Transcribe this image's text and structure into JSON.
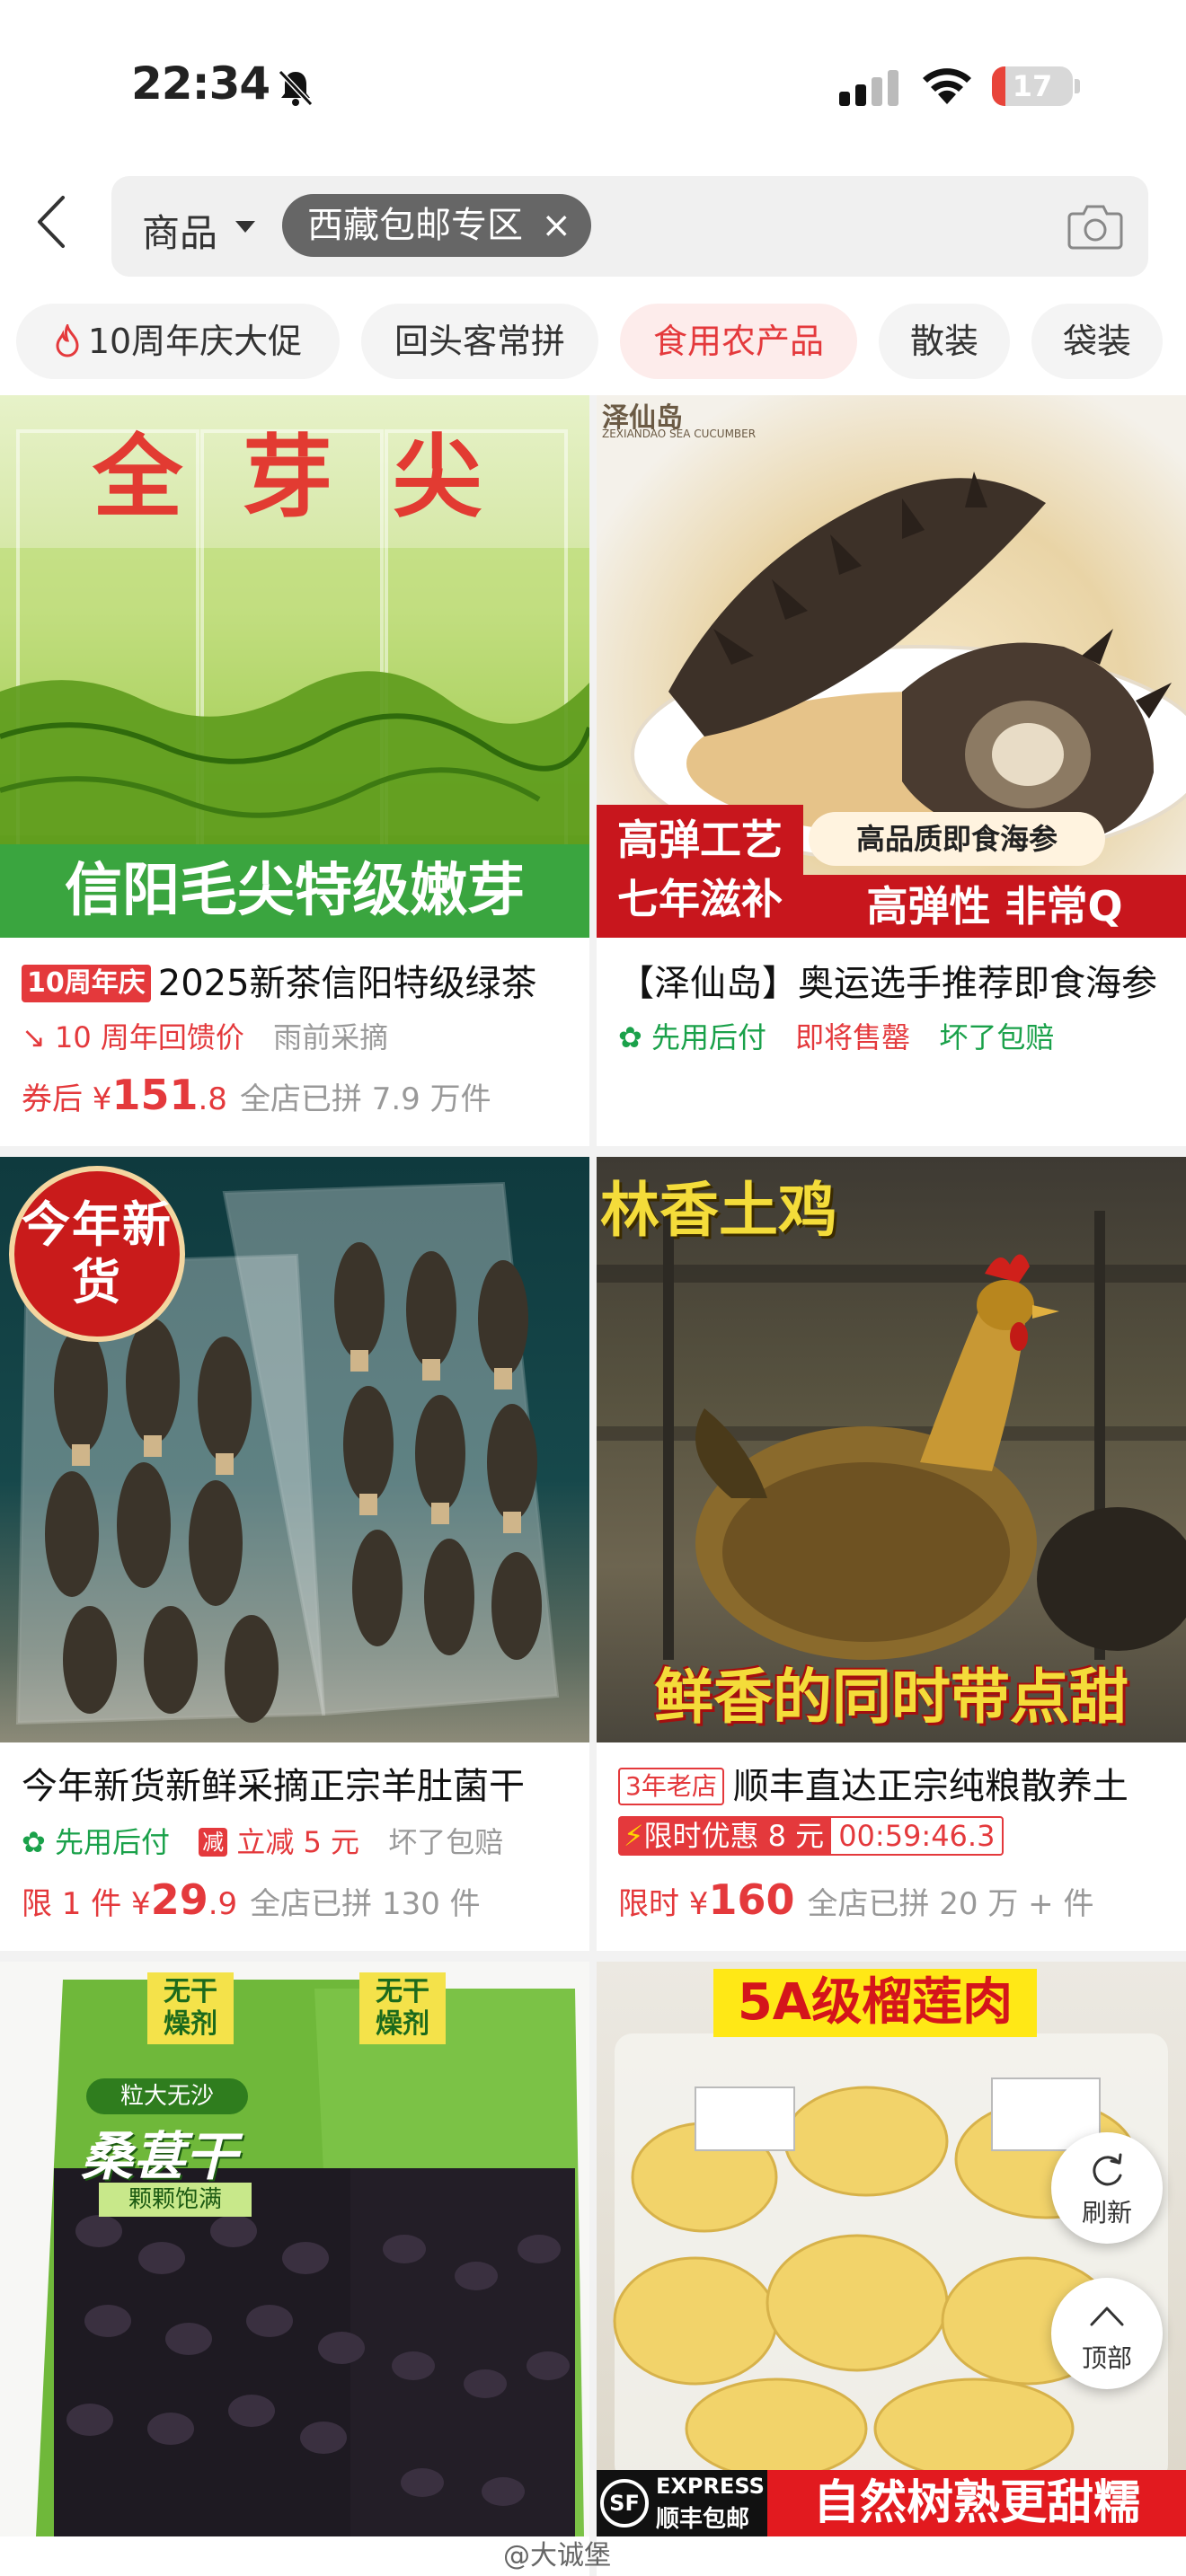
{
  "status_bar": {
    "time": "22:34",
    "battery_text": "17",
    "battery_level": 0.17
  },
  "search": {
    "scope_label": "商品",
    "chip_label": "西藏包邮专区",
    "chip_close": "×"
  },
  "filters": [
    {
      "label": "10周年庆大促"
    },
    {
      "label": "回头客常拼"
    },
    {
      "label": "食用农产品"
    },
    {
      "label": "散装"
    },
    {
      "label": "袋装"
    }
  ],
  "products": [
    {
      "image_top_text": "全 芽 尖",
      "image_bottom_text": "信阳毛尖特级嫩芽",
      "badge": "10周年庆",
      "title": "2025新茶信阳特级绿茶",
      "tag_primary": "10 周年回馈价",
      "tag_secondary": "雨前采摘",
      "price_prefix": "券后 ¥",
      "price_int": "151",
      "price_dec": ".8",
      "sold": "全店已拼 7.9 万件"
    },
    {
      "image_brand": "泽仙岛",
      "image_brand_en": "ZEXIANDAO SEA CUCUMBER",
      "image_label_left_1": "高弹工艺",
      "image_label_left_2": "七年滋补",
      "image_label_right_1": "高品质即食海参",
      "image_label_right_2": "高弹性 非常Q",
      "title": "【泽仙岛】奥运选手推荐即食海参",
      "tag_1": "先用后付",
      "tag_2": "即将售罄",
      "tag_3": "坏了包赔"
    },
    {
      "image_stamp": "今年新货",
      "title": "今年新货新鲜采摘正宗羊肚菌干",
      "tag_1": "先用后付",
      "tag_2_badge": "减",
      "tag_2": "立减 5 元",
      "tag_3": "坏了包赔",
      "price_prefix": "限 1 件 ¥",
      "price_int": "29",
      "price_dec": ".9",
      "sold": "全店已拼 130 件"
    },
    {
      "image_top_text": "林香土鸡",
      "image_bottom_text": "鲜香的同时带点甜",
      "badge": "3年老店",
      "title": "顺丰直达正宗纯粮散养土",
      "tag_flash": "限时优惠 8 元",
      "countdown": "00:59:46.3",
      "price_prefix": "限时 ¥",
      "price_int": "160",
      "price_dec": "",
      "sold": "全店已拼 20 万 + 件"
    },
    {
      "image_label_1": "无干燥剂",
      "image_label_2": "粒大无沙",
      "image_label_3": "桑葚干",
      "image_label_4": "颗颗饱满"
    },
    {
      "image_top_text": "5A级榴莲肉",
      "image_sf": "EXPRESS",
      "image_sf_2": "顺丰包邮",
      "image_bottom_text": "自然树熟更甜糯"
    }
  ],
  "floating": {
    "refresh": "刷新",
    "top": "顶部"
  },
  "watermark": "@大诚堡",
  "colors": {
    "accent": "#e4393c",
    "green": "#1aa14a"
  }
}
